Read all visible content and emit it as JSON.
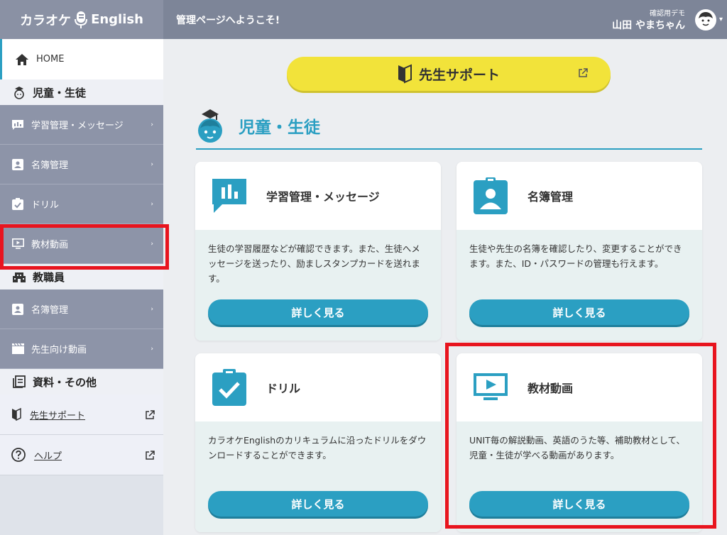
{
  "header": {
    "logo_text": "カラオケ",
    "logo_text2": "English",
    "welcome": "管理ページへようこそ!",
    "user_sub": "確認用デモ",
    "user_name": "山田 やまちゃん",
    "caret": "▾"
  },
  "sidebar": {
    "home": "HOME",
    "section_students": "児童・生徒",
    "items_students": [
      {
        "label": "学習管理・メッセージ"
      },
      {
        "label": "名簿管理"
      },
      {
        "label": "ドリル"
      },
      {
        "label": "教材動画"
      }
    ],
    "section_staff": "教職員",
    "items_staff": [
      {
        "label": "名簿管理"
      },
      {
        "label": "先生向け動画"
      }
    ],
    "section_other": "資料・その他",
    "links": [
      {
        "label": "先生サポート"
      },
      {
        "label": "ヘルプ"
      }
    ],
    "arrow": "›"
  },
  "main": {
    "support_button": "先生サポート",
    "section_title": "児童・生徒",
    "cards": [
      {
        "title": "学習管理・メッセージ",
        "desc": "生徒の学習履歴などが確認できます。また、生徒へメッセージを送ったり、励ましスタンプカードを送れます。",
        "button": "詳しく見る"
      },
      {
        "title": "名簿管理",
        "desc": "生徒や先生の名簿を確認したり、変更することができます。また、ID・パスワードの管理も行えます。",
        "button": "詳しく見る"
      },
      {
        "title": "ドリル",
        "desc": "カラオケEnglishのカリキュラムに沿ったドリルをダウンロードすることができます。",
        "button": "詳しく見る"
      },
      {
        "title": "教材動画",
        "desc": "UNIT毎の解説動画、英語のうた等、補助教材として、児童・生徒が学べる動画があります。",
        "button": "詳しく見る"
      }
    ]
  },
  "colors": {
    "accent": "#2b9fc2",
    "sidebar_item": "#8d94a8",
    "header": "#7d8598",
    "support_yellow": "#f2e33a",
    "highlight_red": "#e8141e"
  }
}
